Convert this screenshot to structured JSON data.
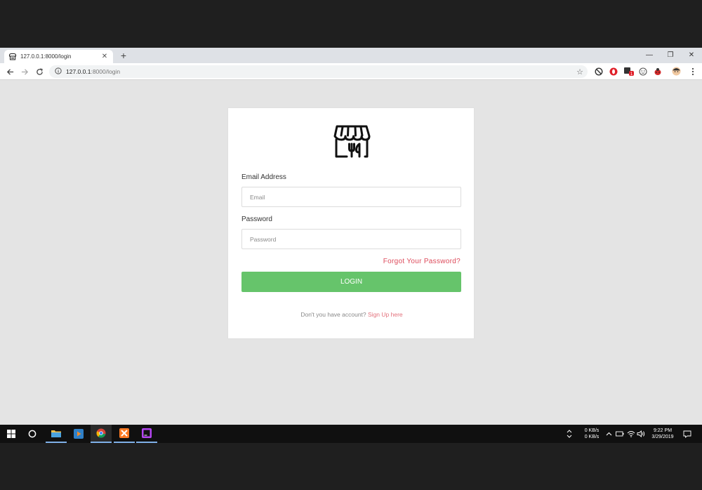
{
  "browser": {
    "tab_title": "127.0.0.1:8000/login",
    "tab_close": "✕",
    "new_tab": "+",
    "url_host": "127.0.0.1",
    "url_path": ":8000/login",
    "window_controls": [
      "—",
      "❐",
      "✕"
    ],
    "extension_badge": "1"
  },
  "login": {
    "email_label": "Email Address",
    "email_placeholder": "Email",
    "password_label": "Password",
    "password_placeholder": "Password",
    "forgot": "Forgot Your Password?",
    "button": "LOGIN",
    "signup_prompt": "Don't you have account?",
    "signup_link": "Sign Up here"
  },
  "taskbar": {
    "net_up": "0 KB/s",
    "net_down": "0 KB/s",
    "time": "9:22 PM",
    "date": "3/29/2019"
  },
  "colors": {
    "accent_green": "#66c46b",
    "link_red": "#dd4b5b"
  }
}
